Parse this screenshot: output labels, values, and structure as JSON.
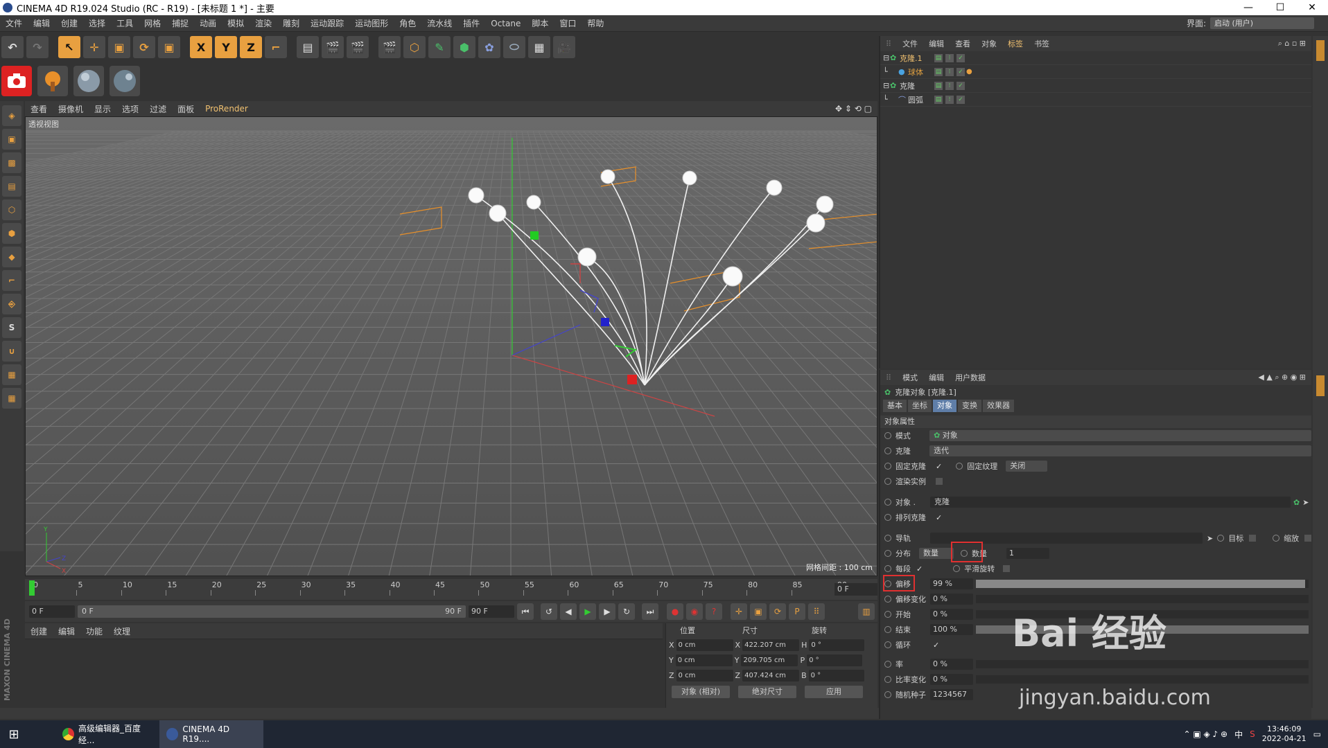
{
  "titlebar": {
    "title": "CINEMA 4D R19.024 Studio (RC - R19) - [未标题 1 *] - 主要",
    "min": "—",
    "max": "☐",
    "close": "✕"
  },
  "menubar": {
    "items": [
      "文件",
      "编辑",
      "创建",
      "选择",
      "工具",
      "网格",
      "捕捉",
      "动画",
      "模拟",
      "渲染",
      "雕刻",
      "运动跟踪",
      "运动图形",
      "角色",
      "流水线",
      "插件",
      "Octane",
      "脚本",
      "窗口",
      "帮助"
    ],
    "interface_label": "界面:",
    "interface_value": "启动 (用户)"
  },
  "toolbar1": [
    "↶",
    "↷",
    "↖",
    "✛",
    "▣",
    "⟳",
    "▣",
    "X",
    "Y",
    "Z",
    "⌐",
    "▤",
    "🎬",
    "🎬",
    "🎬",
    "⬡",
    "✎",
    "⬢",
    "✿",
    "⬭",
    "▦",
    "🎥",
    "💡"
  ],
  "viewport": {
    "menu": [
      "查看",
      "摄像机",
      "显示",
      "选项",
      "过滤",
      "面板",
      "ProRender"
    ],
    "label": "透视视图",
    "grid_spacing": "网格间距 : 100 cm"
  },
  "timeline": {
    "ticks": [
      "0",
      "5",
      "10",
      "15",
      "20",
      "25",
      "30",
      "35",
      "40",
      "45",
      "50",
      "55",
      "60",
      "65",
      "70",
      "75",
      "80",
      "85",
      "90"
    ],
    "current": "0 F",
    "start": "0 F",
    "range_start": "0 F",
    "range_end": "90 F",
    "end": "90 F"
  },
  "material": {
    "menu": [
      "创建",
      "编辑",
      "功能",
      "纹理"
    ],
    "maxon": "MAXON CINEMA 4D"
  },
  "coords": {
    "headers": [
      "位置",
      "尺寸",
      "旋转"
    ],
    "rows": [
      {
        "a": "X",
        "pos": "0 cm",
        "size": "422.207 cm",
        "r": "H",
        "rot": "0 °"
      },
      {
        "a": "Y",
        "pos": "0 cm",
        "size": "209.705 cm",
        "r": "P",
        "rot": "0 °"
      },
      {
        "a": "Z",
        "pos": "0 cm",
        "size": "407.424 cm",
        "r": "B",
        "rot": "0 °"
      }
    ],
    "mode": "对象 (相对)",
    "size_mode": "绝对尺寸",
    "apply": "应用"
  },
  "objects": {
    "menu": [
      "文件",
      "编辑",
      "查看",
      "对象",
      "标签",
      "书签"
    ],
    "items": [
      {
        "name": "克隆.1",
        "color": "#f0c070"
      },
      {
        "name": "球体",
        "color": "#e0a040"
      },
      {
        "name": "克隆",
        "color": "#cfcfcf"
      },
      {
        "name": "圆弧",
        "color": "#cfcfcf"
      }
    ]
  },
  "attributes": {
    "menu": [
      "模式",
      "编辑",
      "用户数据"
    ],
    "title": "克隆对象 [克隆.1]",
    "tabs": [
      "基本",
      "坐标",
      "对象",
      "变换",
      "效果器"
    ],
    "active_tab": "对象",
    "section": "对象属性",
    "mode_label": "模式",
    "mode_value": "对象",
    "clone_label": "克隆",
    "clone_value": "迭代",
    "fix_clone": "固定克隆",
    "fix_texture": "固定纹理",
    "fix_texture_value": "关闭",
    "render_instance": "渲染实例",
    "object_label": "对象 .",
    "object_value": "克隆",
    "arrange": "排列克隆",
    "rail": "导轨",
    "target": "目标",
    "scale": "缩放",
    "distribution": "分布",
    "dist_value": "数量",
    "count_label": "数量",
    "count_value": "1",
    "every_seg": "每段",
    "smooth_rotation": "平滑旋转",
    "offset": "偏移",
    "offset_value": "99 %",
    "offset_frac": 0.99,
    "offset_var": "偏移变化",
    "offset_var_value": "0 %",
    "offset_var_frac": 0,
    "start": "开始",
    "start_value": "0 %",
    "start_frac": 0,
    "end": "结束",
    "end_value": "100 %",
    "end_frac": 1,
    "loop": "循环",
    "rate": "率",
    "rate_value": "0 %",
    "rate_frac": 0,
    "rate_var": "比率变化",
    "rate_var_value": "0 %",
    "rate_var_frac": 0,
    "seed": "随机种子",
    "seed_value": "1234567"
  },
  "taskbar": {
    "tasks": [
      "高级编辑器_百度经...",
      "CINEMA 4D R19...."
    ],
    "ime": "中",
    "time": "13:46:09",
    "date": "2022-04-21"
  },
  "watermark": {
    "main": "Bai 经验",
    "sub": "jingyan.baidu.com"
  }
}
